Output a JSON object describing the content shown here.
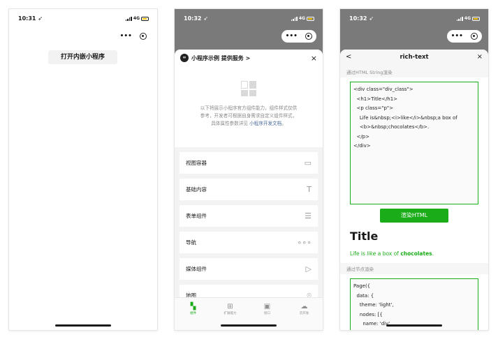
{
  "phone1": {
    "time": "10:31",
    "network": "4G",
    "open_button": "打开内嵌小程序"
  },
  "phone2": {
    "time": "10:32",
    "network": "4G",
    "header_title": "小程序示例 提供服务 >",
    "close": "×",
    "intro_line1": "以下将展示小程序官方组件能力，组件样式仅供",
    "intro_line2": "参考，开发者可根据自身需求自定义组件样式，",
    "intro_line3": "具体属性参数详见",
    "intro_link": "小程序开发文档",
    "intro_end": "。",
    "items": [
      {
        "label": "视图容器",
        "icon": "view-container-icon"
      },
      {
        "label": "基础内容",
        "icon": "text-icon"
      },
      {
        "label": "表单组件",
        "icon": "list-icon"
      },
      {
        "label": "导航",
        "icon": "more-dots-icon"
      },
      {
        "label": "媒体组件",
        "icon": "play-icon"
      },
      {
        "label": "地图",
        "icon": "location-icon"
      }
    ],
    "tabs": [
      {
        "label": "组件",
        "icon": "component-icon",
        "active": true
      },
      {
        "label": "扩展能力",
        "icon": "extension-icon",
        "active": false
      },
      {
        "label": "接口",
        "icon": "api-icon",
        "active": false
      },
      {
        "label": "云开发",
        "icon": "cloud-icon",
        "active": false
      }
    ]
  },
  "phone3": {
    "time": "10:32",
    "network": "4G",
    "back": "<",
    "title": "rich-text",
    "close": "×",
    "section1": "通过HTML String渲染",
    "code_lines": [
      "<div class=\"div_class\">",
      "  <h1>Title</h1>",
      "  <p class=\"p\">",
      "    Life is&nbsp;<i>like</i>&nbsp;a box of",
      "    <b>&nbsp;chocolates</b>.",
      "  </p>",
      "</div>"
    ],
    "render_button": "渲染HTML",
    "result_title": "Title",
    "result_p_start": "Life is ",
    "result_p_italic": "like",
    "result_p_mid": " a box of ",
    "result_p_bold": "chocolates",
    "result_p_end": ".",
    "section2": "通过节点渲染",
    "node_lines": [
      "Page({",
      "  data: {",
      "    theme: 'light',",
      "    nodes: [{",
      "      name: 'div',"
    ]
  },
  "colors": {
    "accent_green": "#1aad19",
    "battery_yellow": "#f5c400",
    "overlay_gray": "#7a7a7a"
  }
}
